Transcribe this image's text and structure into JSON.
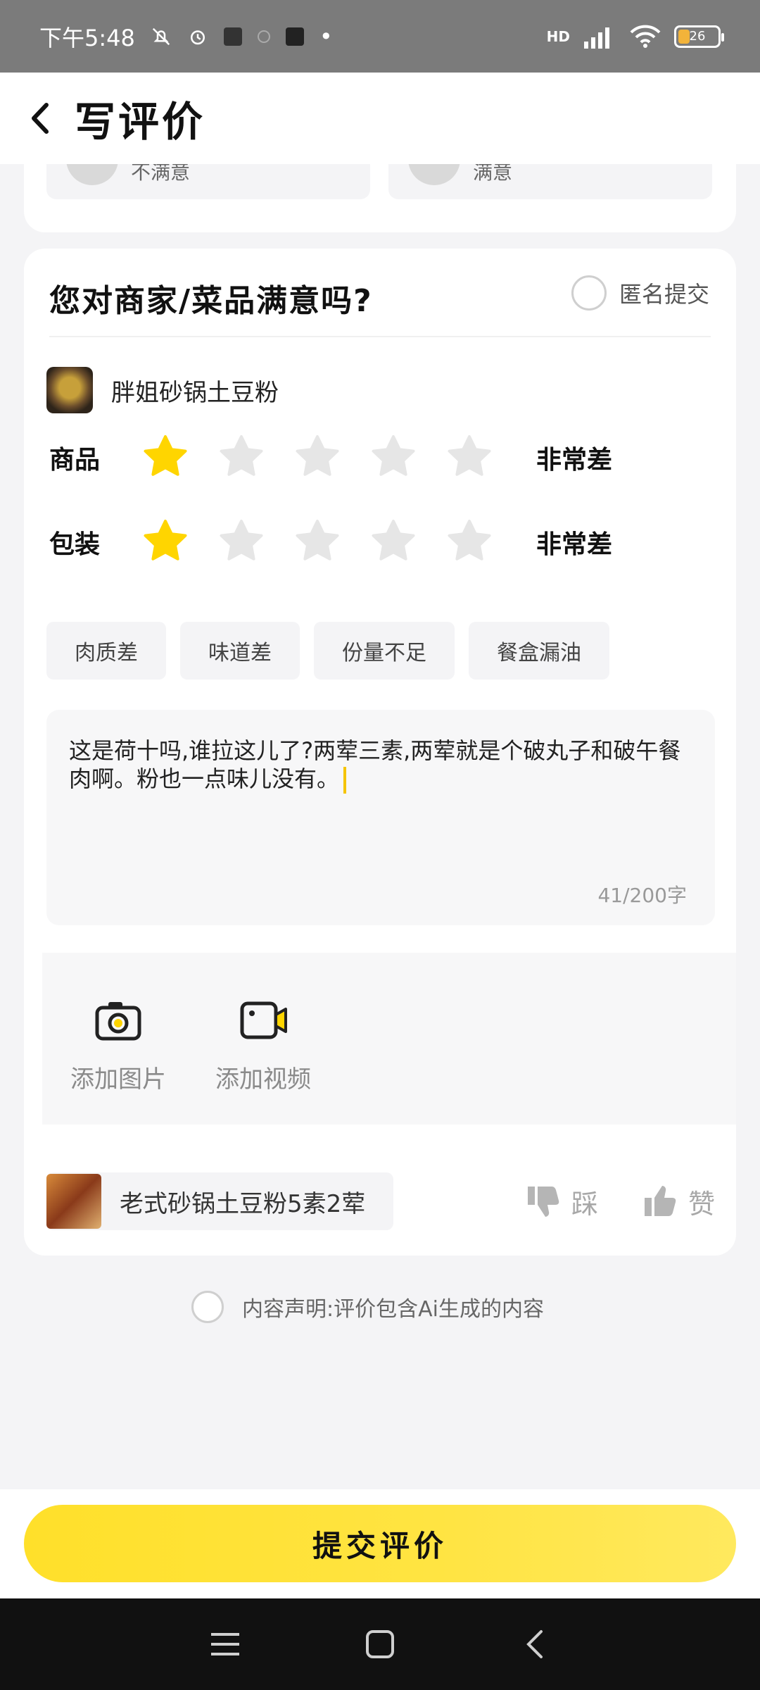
{
  "status_bar": {
    "time": "下午5:48",
    "network": "HD",
    "battery": "26"
  },
  "header": {
    "title": "写评价"
  },
  "previous_section": {
    "options": [
      "不满意",
      "满意"
    ]
  },
  "review": {
    "question": "您对商家/菜品满意吗?",
    "anonymous_label": "匿名提交",
    "dish_name": "胖姐砂锅土豆粉",
    "ratings": [
      {
        "label": "商品",
        "value": 1,
        "max": 5,
        "verdict": "非常差"
      },
      {
        "label": "包装",
        "value": 1,
        "max": 5,
        "verdict": "非常差"
      }
    ],
    "tags": [
      "肉质差",
      "味道差",
      "份量不足",
      "餐盒漏油"
    ],
    "text": "这是荷十吗,谁拉这儿了?两荤三素,两荤就是个破丸子和破午餐肉啊。粉也一点味儿没有。",
    "counter": "41/200字",
    "media": {
      "add_photo": "添加图片",
      "add_video": "添加视频"
    },
    "ai_suggestion": "老式砂锅土豆粉5素2荤",
    "dislike": "踩",
    "like": "赞"
  },
  "statement": "内容声明:评价包含Ai生成的内容",
  "submit_label": "提交评价",
  "colors": {
    "accent": "#ffe03a",
    "star_active": "#ffd500",
    "star_inactive": "#e6e6e6"
  }
}
